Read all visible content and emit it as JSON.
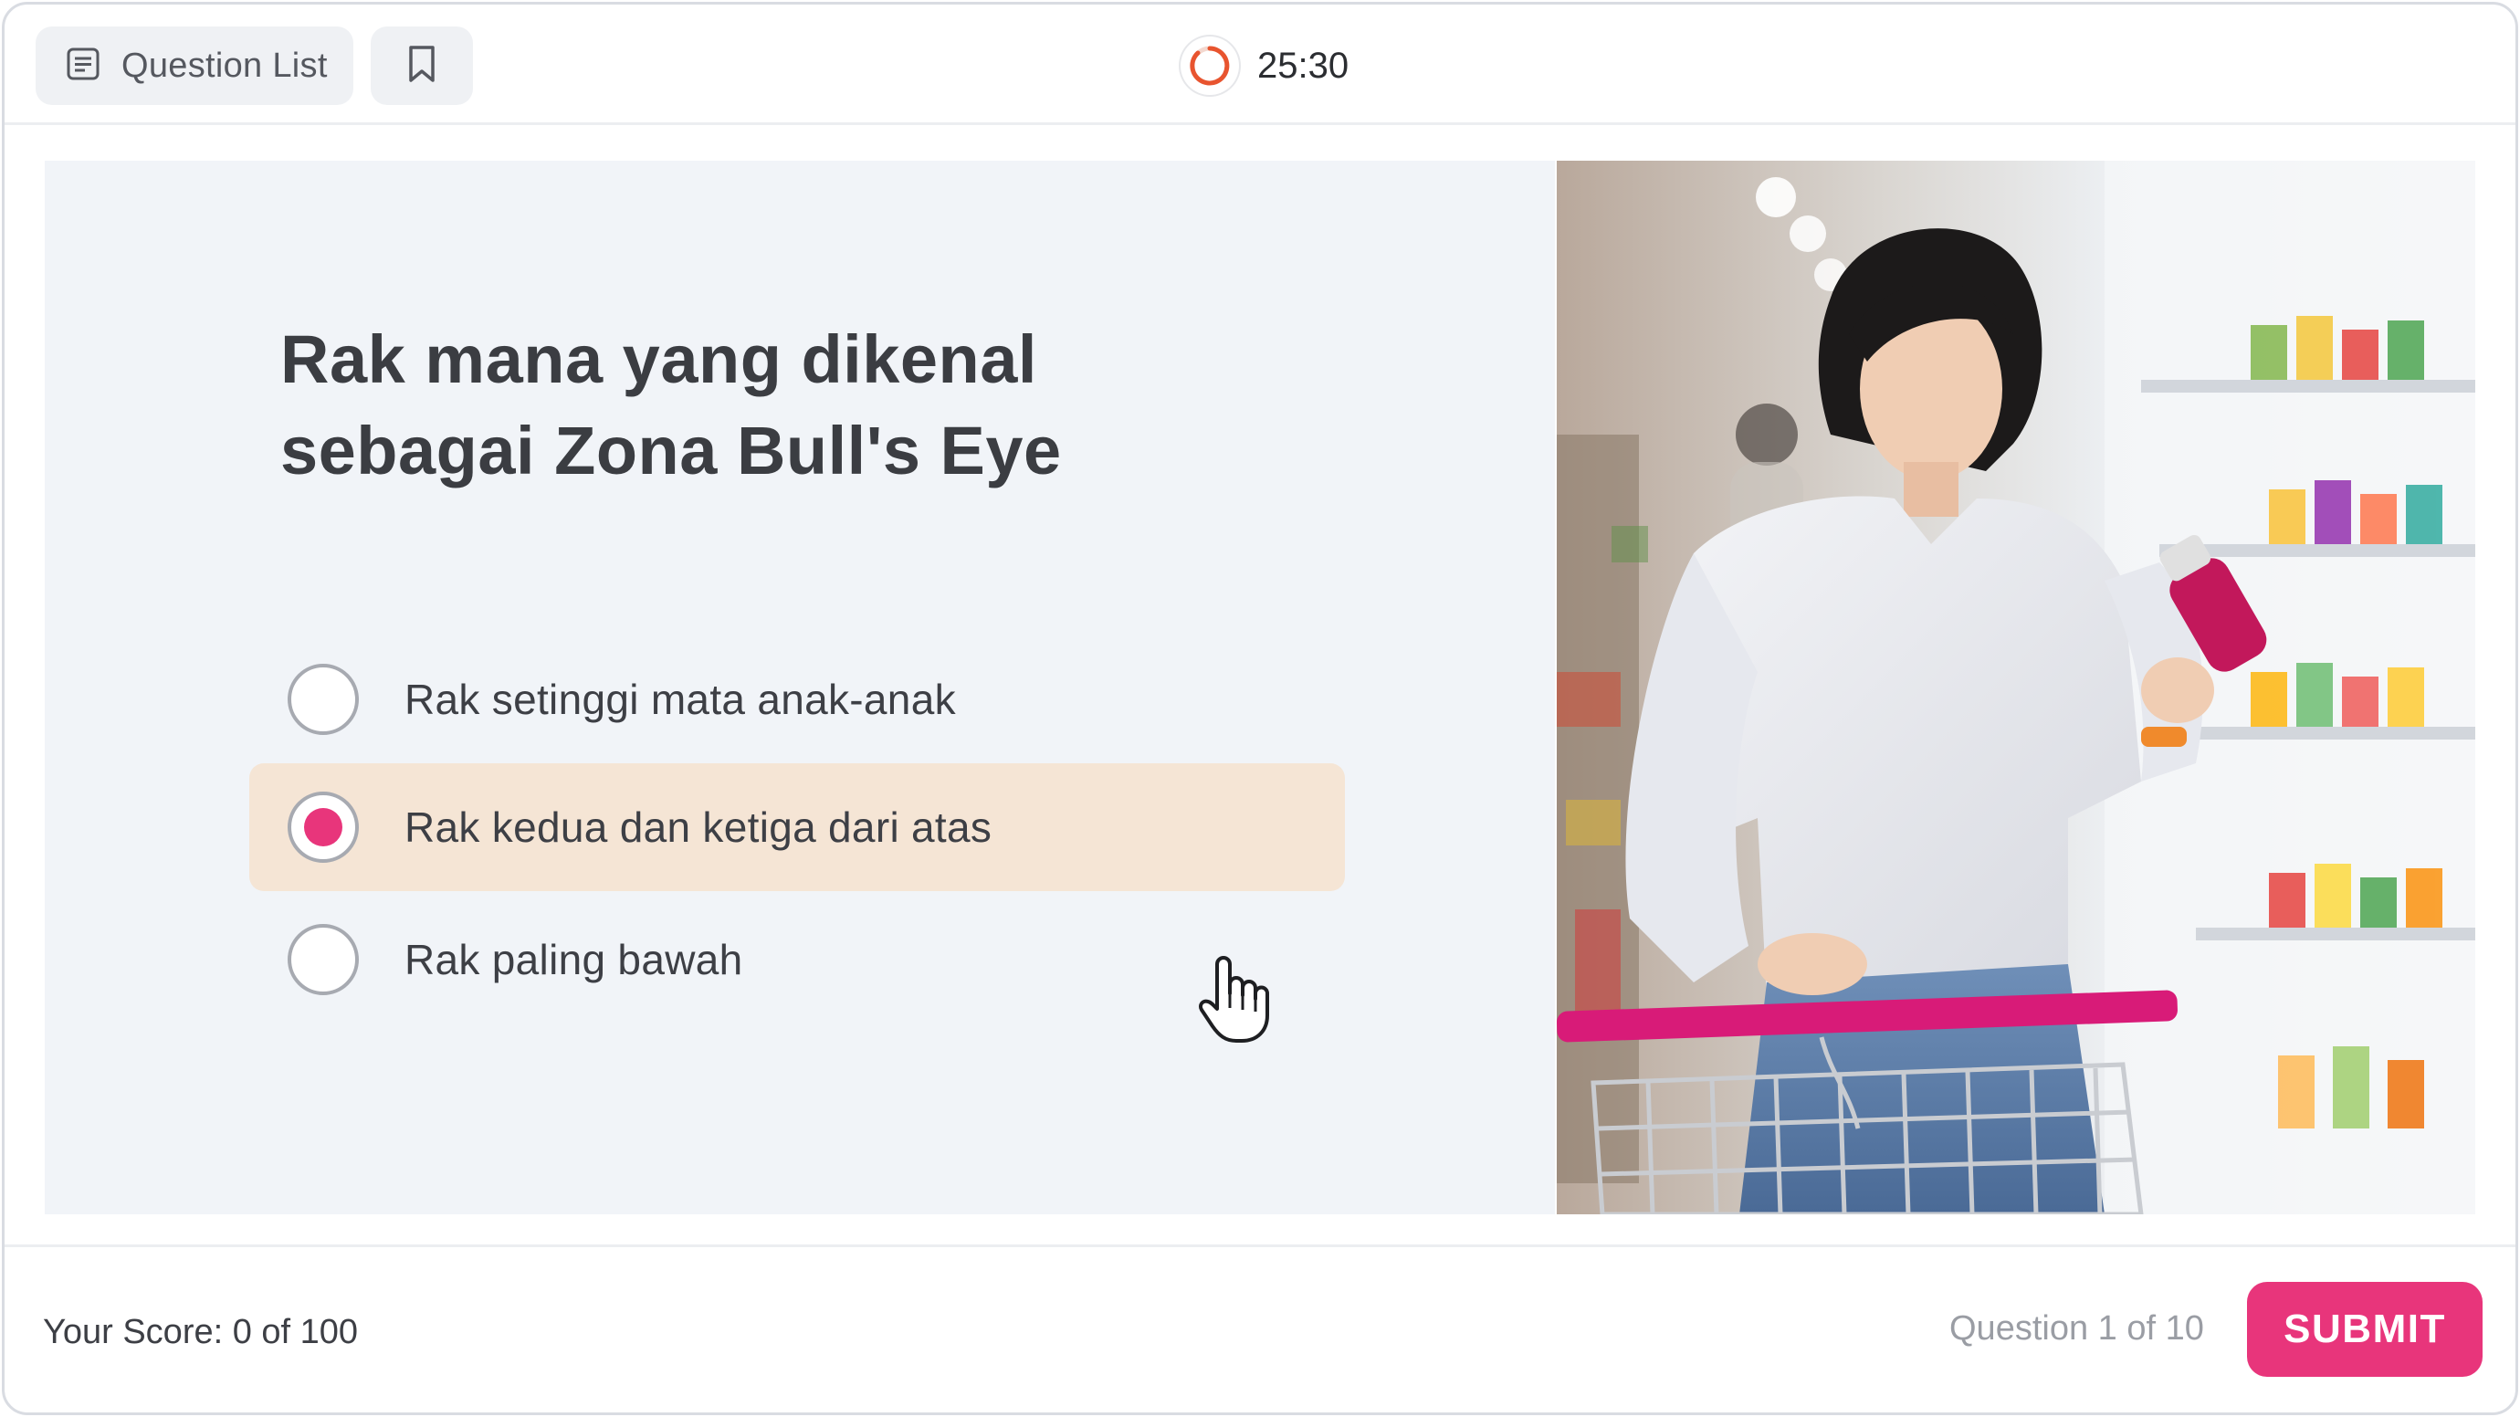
{
  "header": {
    "question_list_label": "Question List",
    "timer": "25:30"
  },
  "question": {
    "title_line1": "Rak mana yang dikenal",
    "title_line2": "sebagai Zona Bull's Eye",
    "options": [
      {
        "label": "Rak setinggi mata anak-anak",
        "selected": false
      },
      {
        "label": "Rak kedua dan ketiga dari atas",
        "selected": true
      },
      {
        "label": "Rak paling bawah",
        "selected": false
      }
    ]
  },
  "footer": {
    "score": "Your Score: 0 of 100",
    "progress": "Question 1 of 10",
    "submit_label": "SUBMIT"
  },
  "colors": {
    "accent": "#e8357b",
    "selected_option_bg": "#f5e5d5",
    "panel_bg": "#f1f4f8",
    "timer_ring": "#e8542f"
  },
  "icons": {
    "question_list": "list-document-icon",
    "bookmark": "bookmark-icon",
    "timer": "timer-ring-icon",
    "cursor": "hand-pointer-icon"
  }
}
